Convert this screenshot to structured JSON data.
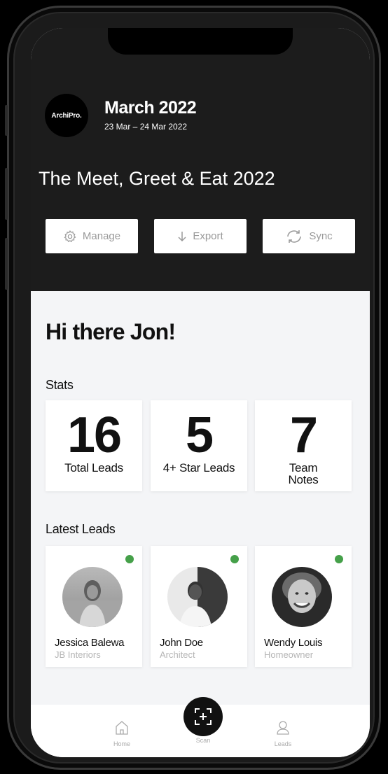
{
  "header": {
    "logo": "ArchiPro.",
    "month": "March 2022",
    "date_range": "23 Mar – 24 Mar 2022",
    "event_title": "The Meet, Greet & Eat 2022"
  },
  "actions": [
    {
      "label": "Manage",
      "icon": "gear-icon"
    },
    {
      "label": "Export",
      "icon": "arrow-down-icon"
    },
    {
      "label": "Sync",
      "icon": "sync-icon"
    }
  ],
  "greeting": "Hi there Jon!",
  "stats": {
    "title": "Stats",
    "items": [
      {
        "value": "16",
        "label": "Total Leads"
      },
      {
        "value": "5",
        "label": "4+ Star Leads"
      },
      {
        "value": "7",
        "label": "Team Notes"
      }
    ]
  },
  "latest_leads": {
    "title": "Latest Leads",
    "items": [
      {
        "name": "Jessica Balewa",
        "role": "JB Interiors",
        "status_color": "#45a049"
      },
      {
        "name": "John Doe",
        "role": "Architect",
        "status_color": "#45a049"
      },
      {
        "name": "Wendy Louis",
        "role": "Homeowner",
        "status_color": "#45a049"
      }
    ]
  },
  "tabbar": {
    "home": {
      "label": "Home",
      "icon": "home-icon"
    },
    "scan": {
      "label": "Scan",
      "icon": "scan-icon"
    },
    "leads": {
      "label": "Leads",
      "icon": "user-icon"
    }
  },
  "colors": {
    "header_bg": "#1c1c1c",
    "content_bg": "#f4f5f7",
    "status_online": "#45a049"
  }
}
